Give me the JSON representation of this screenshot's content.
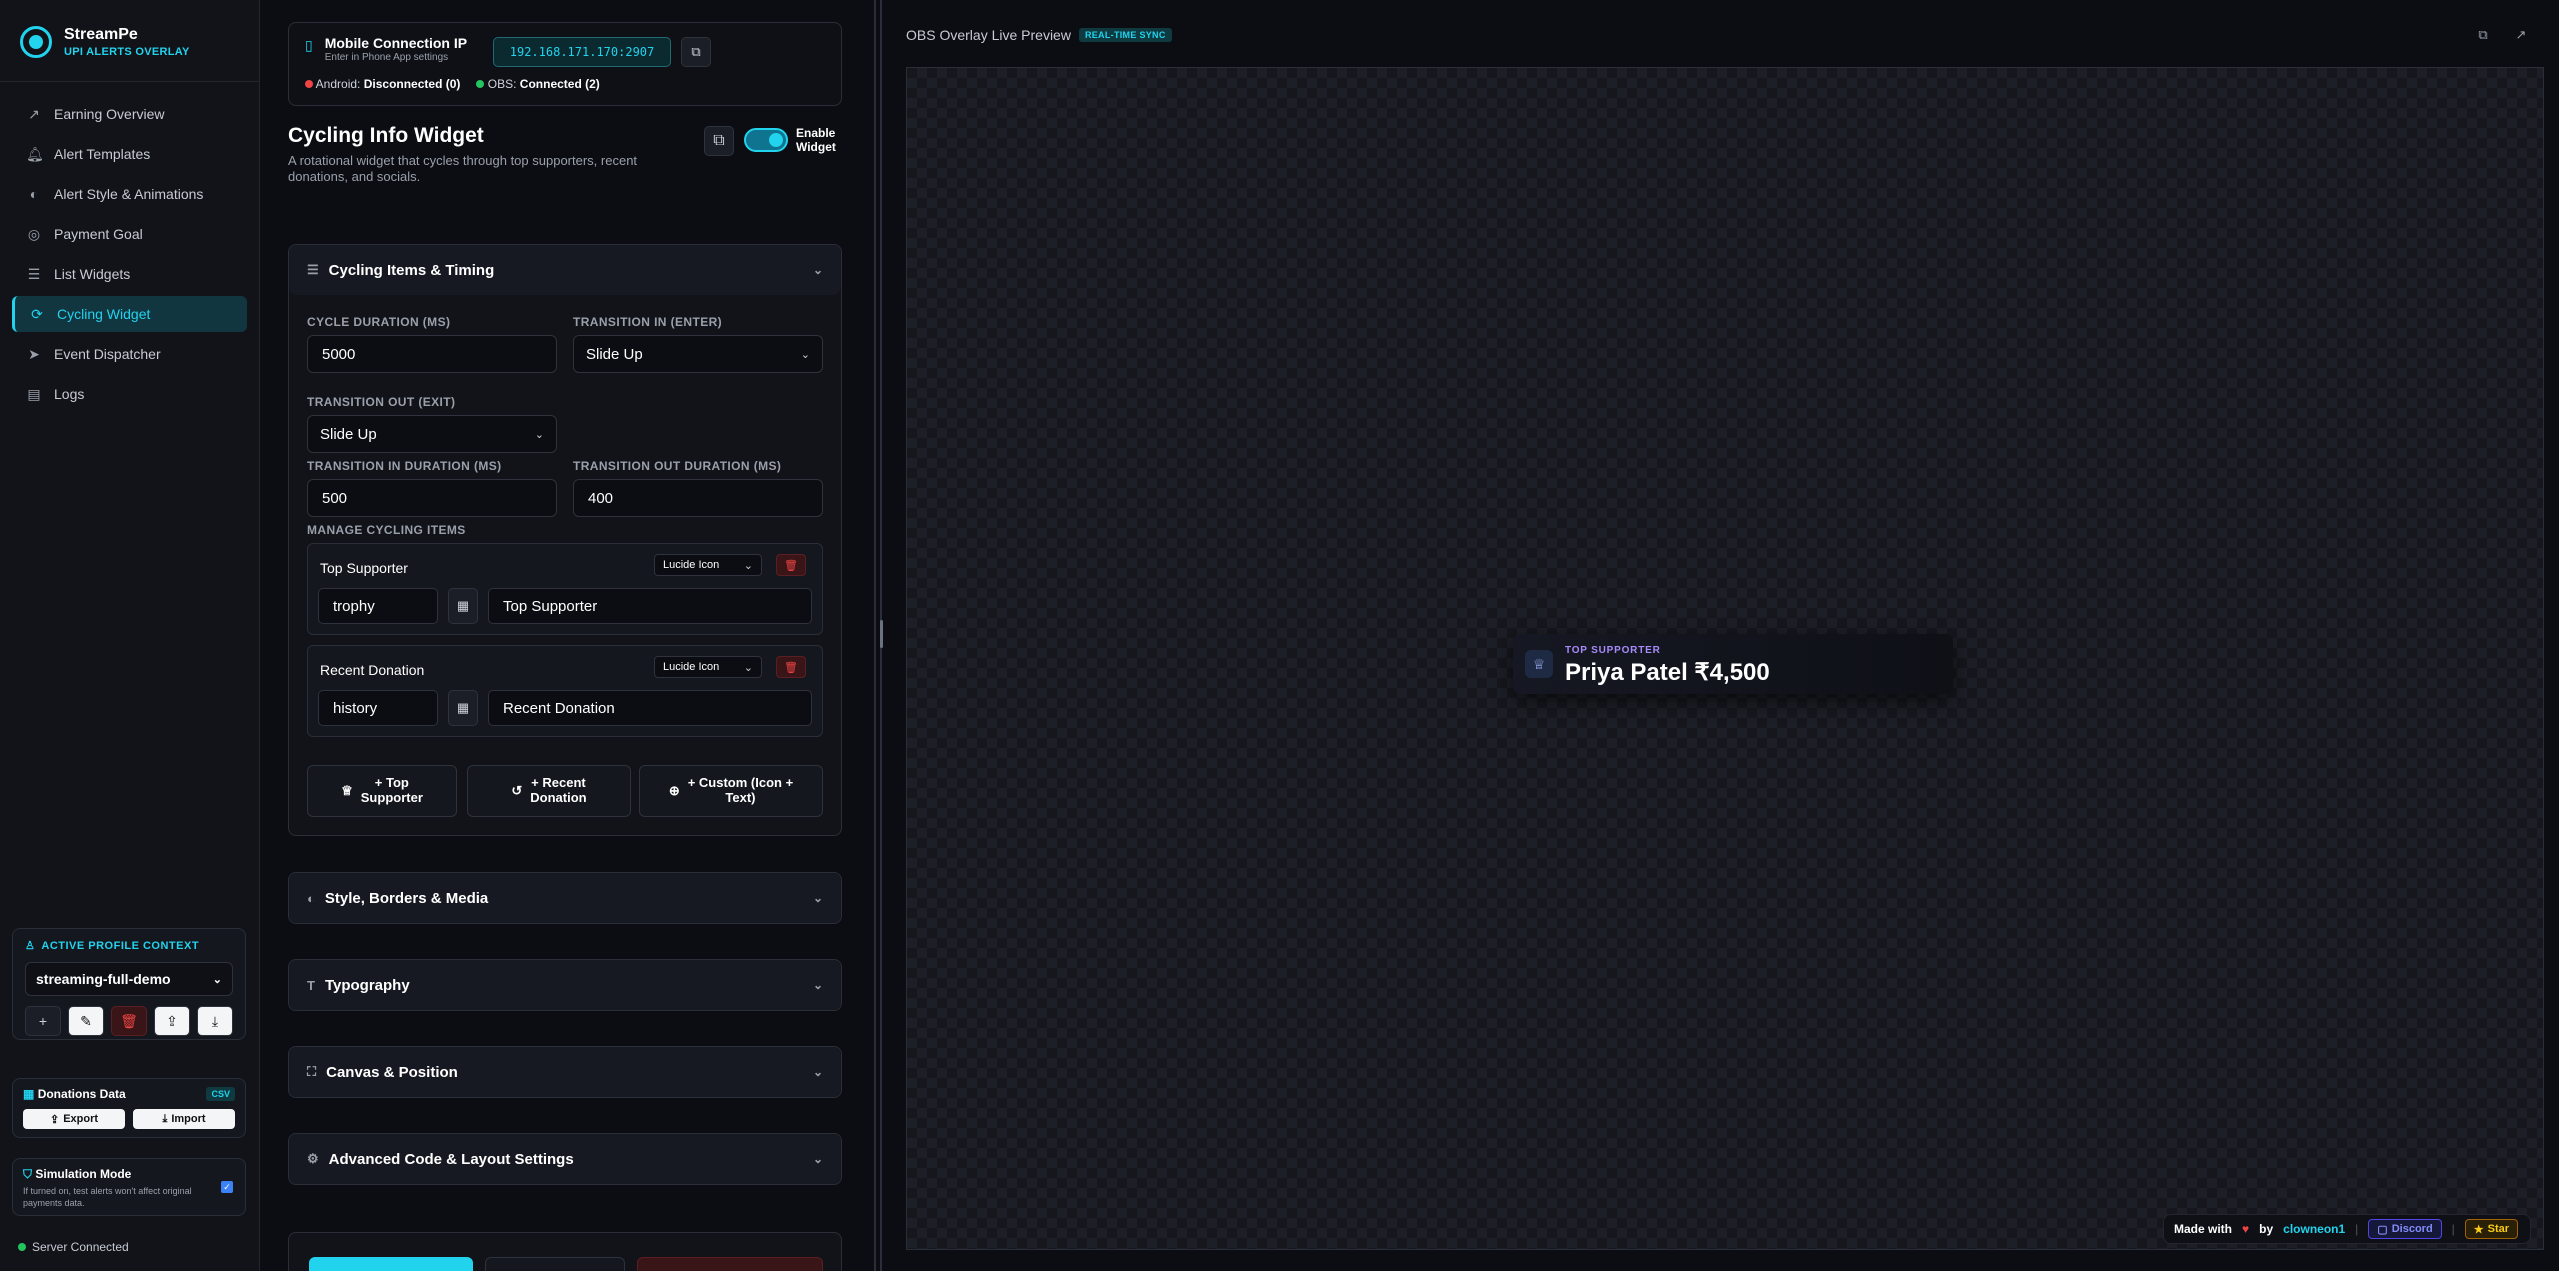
{
  "brand": {
    "name": "StreamPe",
    "subtitle": "UPI ALERTS OVERLAY"
  },
  "nav": [
    {
      "label": "Earning Overview",
      "icon": "trend-icon"
    },
    {
      "label": "Alert Templates",
      "icon": "bell-icon"
    },
    {
      "label": "Alert Style & Animations",
      "icon": "palette-icon"
    },
    {
      "label": "Payment Goal",
      "icon": "target-icon"
    },
    {
      "label": "List Widgets",
      "icon": "list-icon"
    },
    {
      "label": "Cycling Widget",
      "icon": "refresh-icon",
      "active": true
    },
    {
      "label": "Event Dispatcher",
      "icon": "send-icon"
    },
    {
      "label": "Logs",
      "icon": "clipboard-icon"
    }
  ],
  "profile": {
    "title": "ACTIVE PROFILE CONTEXT",
    "selected": "streaming-full-demo"
  },
  "donations": {
    "title": "Donations Data",
    "badge": "CSV",
    "export_label": "Export",
    "import_label": "Import"
  },
  "simulation": {
    "title": "Simulation Mode",
    "description": "If turned on, test alerts won't affect original payments data.",
    "checked": true
  },
  "server": {
    "status": "Server Connected"
  },
  "connection": {
    "title": "Mobile Connection IP",
    "subtitle": "Enter in Phone App settings",
    "ip": "192.168.171.170:2907",
    "android_label": "Android:",
    "android_status": "Disconnected (0)",
    "obs_label": "OBS:",
    "obs_status": "Connected (2)"
  },
  "widget": {
    "title": "Cycling Info Widget",
    "description": "A rotational widget that cycles through top supporters, recent donations, and socials.",
    "enable_label_1": "Enable",
    "enable_label_2": "Widget",
    "enabled": true
  },
  "cycling_section": {
    "title": "Cycling Items & Timing",
    "cycle_duration_label": "CYCLE DURATION (MS)",
    "cycle_duration": "5000",
    "transition_in_label": "TRANSITION IN (ENTER)",
    "transition_in": "Slide Up",
    "transition_out_label": "TRANSITION OUT (EXIT)",
    "transition_out": "Slide Up",
    "transition_in_duration_label": "TRANSITION IN DURATION (MS)",
    "transition_in_duration": "500",
    "transition_out_duration_label": "TRANSITION OUT DURATION (MS)",
    "transition_out_duration": "400",
    "manage_label": "MANAGE CYCLING ITEMS",
    "items": [
      {
        "title": "Top Supporter",
        "icon_type": "Lucide Icon",
        "icon": "trophy",
        "text": "Top Supporter"
      },
      {
        "title": "Recent Donation",
        "icon_type": "Lucide Icon",
        "icon": "history",
        "text": "Recent Donation"
      }
    ],
    "add_top_1": "+ Top",
    "add_top_2": "Supporter",
    "add_recent_1": "+ Recent",
    "add_recent_2": "Donation",
    "add_custom_1": "+ Custom (Icon +",
    "add_custom_2": "Text)"
  },
  "sections": [
    {
      "title": "Style, Borders & Media",
      "icon": "palette-icon"
    },
    {
      "title": "Typography",
      "icon": "type-icon"
    },
    {
      "title": "Canvas & Position",
      "icon": "expand-icon"
    },
    {
      "title": "Advanced Code & Layout Settings",
      "icon": "gear-icon"
    }
  ],
  "preview": {
    "title": "OBS Overlay Live Preview",
    "badge": "REAL-TIME SYNC",
    "overlay_label": "TOP SUPPORTER",
    "overlay_value": "Priya Patel ₹4,500"
  },
  "footer": {
    "made_with": "Made with",
    "by": "by",
    "author": "clowneon1",
    "discord": "Discord",
    "star": "Star"
  },
  "colors": {
    "accent": "#22d3ee",
    "background": "#0b0d12",
    "danger": "#ef4444",
    "success": "#22c55e"
  }
}
